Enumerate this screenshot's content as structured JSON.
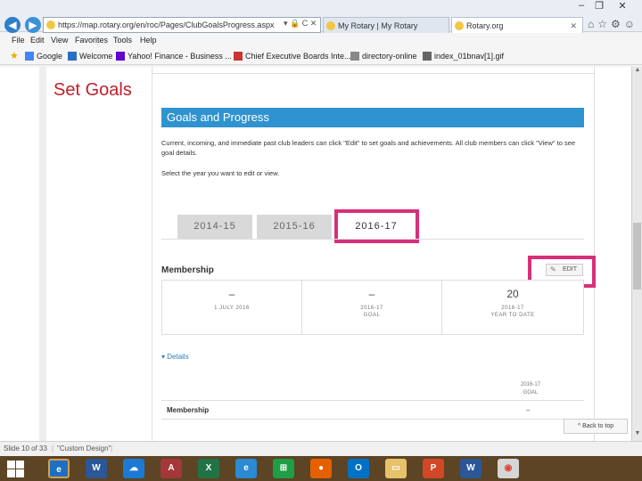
{
  "browser": {
    "address": "https://map.rotary.org/en/roc/Pages/ClubGoalsProgress.aspx",
    "address_icons": "▾ 🔒 C ✕",
    "tabs": [
      {
        "label": "My Rotary | My Rotary"
      },
      {
        "label": "Rotary.org"
      }
    ],
    "menu": [
      "File",
      "Edit",
      "View",
      "Favorites",
      "Tools",
      "Help"
    ],
    "favorites": [
      "Google",
      "Welcome",
      "Yahoo! Finance - Business ...",
      "Chief Executive Boards Inte...",
      "directory-online",
      "index_01bnav[1].gif"
    ]
  },
  "slide": {
    "title": "Set Goals"
  },
  "page": {
    "section_title": "Goals and Progress",
    "intro": "Current, incoming, and immediate past club leaders can click \"Edit\" to set goals and achievements. All club members can click \"View\" to see goal details.",
    "select_year": "Select the year you want to edit or view.",
    "year_tabs": [
      "2014-15",
      "2015-16",
      "2016-17"
    ],
    "membership_heading": "Membership",
    "edit_label": "EDIT",
    "stats": [
      {
        "value": "–",
        "sub": "1 JULY 2016"
      },
      {
        "value": "–",
        "sub": "2016-17\nGOAL"
      },
      {
        "value": "20",
        "sub": "2016-17\nYEAR TO DATE"
      }
    ],
    "details_label": "Details",
    "col_head": "2016-17\nGOAL",
    "row_label": "Membership",
    "row_value": "–",
    "back_to_top": "^ Back to top"
  },
  "statusbar": {
    "slide_info": "Slide 10 of 33",
    "design": "\"Custom Design\""
  },
  "colors": {
    "section_header": "#2f93cf",
    "highlight": "#d82f7a",
    "set_goals": "#c0202a",
    "taskbar": "#5c4425"
  },
  "taskbar_icons": [
    "windows-start-icon",
    "internet-explorer-icon",
    "word-icon",
    "onedrive-icon",
    "access-icon",
    "excel-icon",
    "internet-explorer-icon",
    "store-icon",
    "firefox-icon",
    "outlook-icon",
    "file-explorer-icon",
    "powerpoint-icon",
    "word-icon",
    "chrome-icon"
  ]
}
